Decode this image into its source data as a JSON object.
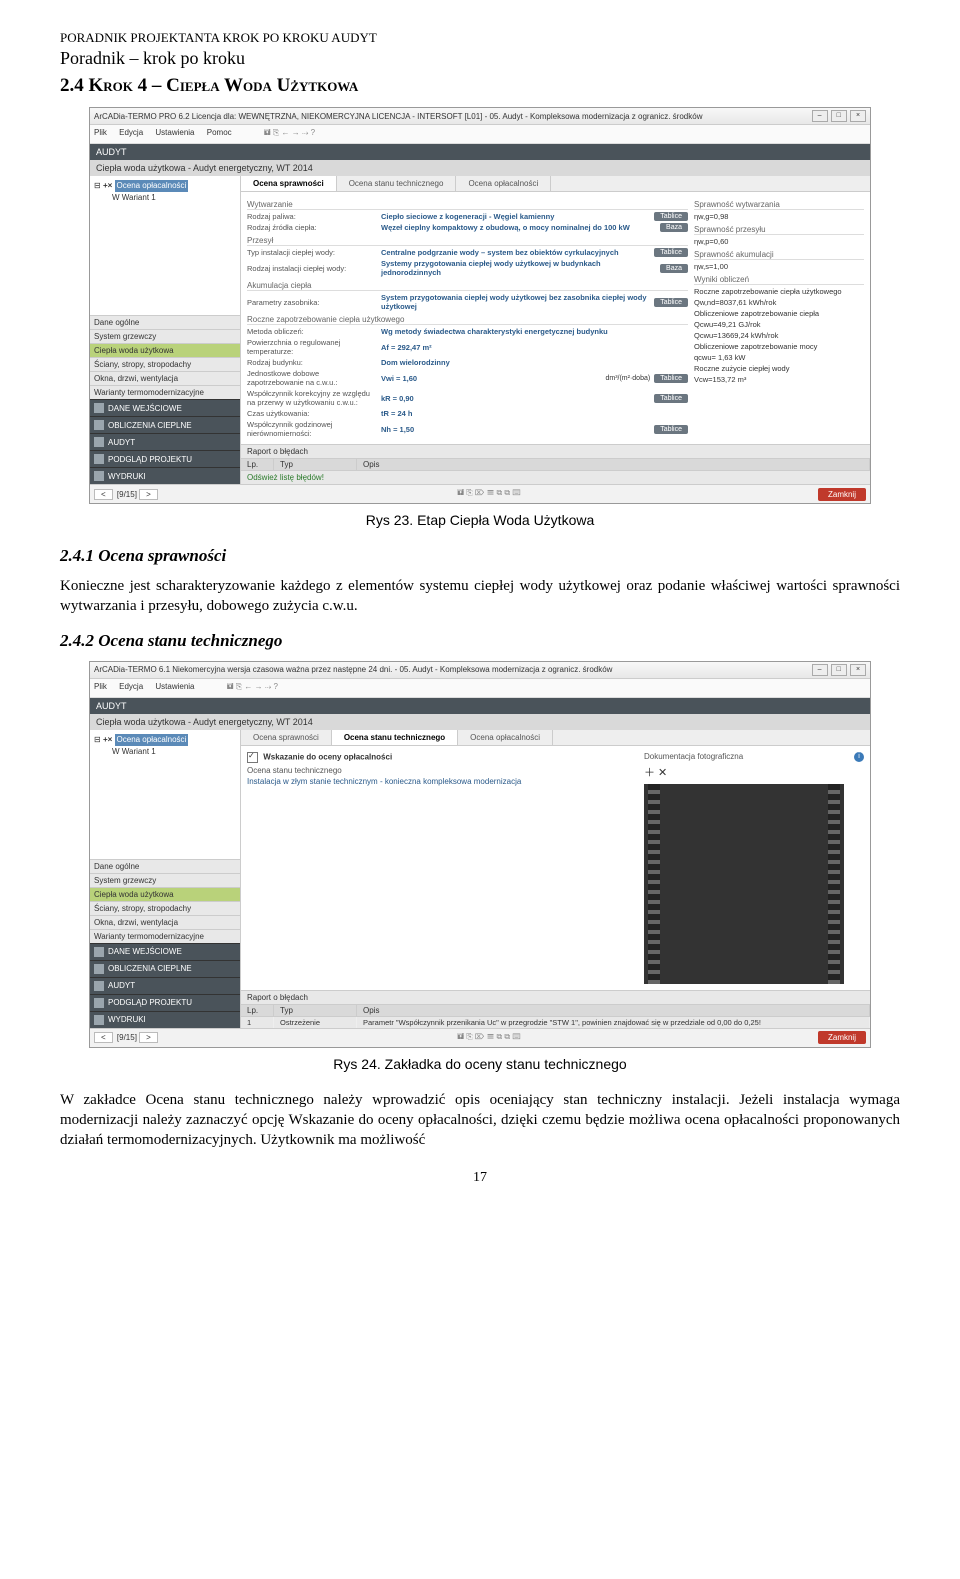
{
  "doc": {
    "header": "PORADNIK PROJEKTANTA KROK PO KROKU AUDYT",
    "subtitle": "Poradnik – krok  po kroku",
    "section": "2.4 Krok 4 – Ciepła Woda Użytkowa",
    "caption1": "Rys 23. Etap Ciepła Woda Użytkowa",
    "sub1_title": "2.4.1  Ocena sprawności",
    "sub1_body": "Konieczne jest scharakteryzowanie każdego z elementów systemu ciepłej wody użytkowej oraz podanie właściwej wartości sprawności wytwarzania i przesyłu, dobowego zużycia c.w.u.",
    "sub2_title": "2.4.2  Ocena stanu technicznego",
    "caption2": "Rys 24. Zakładka do oceny stanu technicznego",
    "final_body": "W zakładce Ocena stanu technicznego należy wprowadzić opis oceniający stan techniczny instalacji. Jeżeli instalacja wymaga modernizacji należy zaznaczyć opcję Wskazanie do oceny opłacalności, dzięki czemu będzie możliwa ocena opłacalności proponowanych działań termomodernizacyjnych. Użytkownik ma możliwość",
    "page_num": "17"
  },
  "app1": {
    "title": "ArCADia-TERMO PRO 6.2 Licencja dla: WEWNĘTRZNA, NIEKOMERCYJNA LICENCJA - INTERSOFT [L01] - 05. Audyt - Kompleksowa modernizacja z ogranicz. środków",
    "menu": [
      "Plik",
      "Edycja",
      "Ustawienia",
      "Pomoc"
    ],
    "audyt_label": "AUDYT",
    "context": "Ciepła woda użytkowa - Audyt energetyczny, WT 2014",
    "tree_top": "Ocena opłacalności",
    "tree_variant": "W  Wariant 1",
    "sidebar_groups": [
      "Dane ogólne",
      "System grzewczy",
      "Ciepła woda użytkowa",
      "Ściany, stropy, stropodachy",
      "Okna, drzwi, wentylacja",
      "Warianty termomodernizacyjne"
    ],
    "sidebar_dark": [
      "DANE WEJŚCIOWE",
      "OBLICZENIA CIEPLNE",
      "AUDYT",
      "PODGLĄD PROJEKTU",
      "WYDRUKI"
    ],
    "tabs": [
      "Ocena sprawności",
      "Ocena stanu technicznego",
      "Ocena opłacalności"
    ],
    "grp_wytwarzanie": "Wytwarzanie",
    "row_rodzaj_paliwa_l": "Rodzaj paliwa:",
    "row_rodzaj_paliwa_v": "Ciepło sieciowe z kogeneracji - Węgiel kamienny",
    "row_rodzaj_zrodla_l": "Rodzaj źródła ciepła:",
    "row_rodzaj_zrodla_v": "Węzeł cieplny kompaktowy z obudową, o mocy nominalnej do 100 kW",
    "grp_przesyl": "Przesył",
    "row_typ_inst_l": "Typ instalacji ciepłej wody:",
    "row_typ_inst_v": "Centralne podgrzanie wody – system bez obiektów cyrkulacyjnych",
    "row_rodzaj_inst_l": "Rodzaj instalacji ciepłej wody:",
    "row_rodzaj_inst_v": "Systemy przygotowania ciepłej wody użytkowej w budynkach jednorodzinnych",
    "grp_akumulacja": "Akumulacja ciepła",
    "row_param_zas_l": "Parametry zasobnika:",
    "row_param_zas_v": "System przygotowania ciepłej wody użytkowej bez zasobnika ciepłej wody użytkowej",
    "grp_roczne": "Roczne zapotrzebowanie ciepła użytkowego",
    "row_metoda_l": "Metoda obliczeń:",
    "row_metoda_v": "Wg metody świadectwa charakterystyki energetycznej budynku",
    "row_pow_l": "Powierzchnia o regulowanej temperaturze:",
    "row_pow_v": "Af = 292,47 m²",
    "row_rodzaj_bud_l": "Rodzaj budynku:",
    "row_rodzaj_bud_v": "Dom wielorodzinny",
    "row_jedn_l": "Jednostkowe dobowe zapotrzebowanie na c.w.u.:",
    "row_jedn_v": "Vwi = 1,60",
    "row_jedn_u": "dm³/(m²·doba)",
    "row_wsp_l": "Współczynnik korekcyjny ze względu na przerwy w użytkowaniu c.w.u.:",
    "row_wsp_v": "kR = 0,90",
    "row_czas_l": "Czas użytkowania:",
    "row_czas_v": "tR = 24 h",
    "row_wsp_godz_l": "Współczynnik godzinowej nierównomierności:",
    "row_wsp_godz_v": "Nh = 1,50",
    "btn_tablice": "Tablice",
    "btn_baza": "Baza",
    "right_grp1": "Sprawność wytwarzania",
    "right_v1": "ηw,g=0,98",
    "right_grp2": "Sprawność przesyłu",
    "right_v2": "ηw,p=0,60",
    "right_grp3": "Sprawność akumulacji",
    "right_v3": "ηw,s=1,00",
    "right_grp4": "Wyniki obliczeń",
    "res1_l": "Roczne zapotrzebowanie ciepła użytkowego",
    "res1_v": "Qw,nd=8037,61 kWh/rok",
    "res2_l": "Obliczeniowe zapotrzebowanie ciepła",
    "res2_v": "Qcwu=49,21 GJ/rok",
    "res3_l": "",
    "res3_v": "Qcwu=13669,24 kWh/rok",
    "res4_l": "Obliczeniowe zapotrzebowanie mocy",
    "res4_v": "qcwu= 1,63 kW",
    "res5_l": "Roczne zużycie ciepłej wody",
    "res5_v": "Vcw=153,72 m³",
    "raport_title": "Raport o błędach",
    "rhdr": [
      "Lp.",
      "Typ",
      "Opis"
    ],
    "refresh": "Odśwież listę błędów!",
    "status_page": "[9/15]",
    "close": "Zamknij"
  },
  "app2": {
    "title": "ArCADia-TERMO 6.1 Niekomercyjna wersja czasowa ważna przez następne 24 dni. - 05. Audyt - Kompleksowa modernizacja z ogranicz. środków",
    "menu": [
      "Plik",
      "Edycja",
      "Ustawienia"
    ],
    "audyt_label": "AUDYT",
    "context": "Ciepła woda użytkowa - Audyt energetyczny, WT 2014",
    "tree_top": "Ocena opłacalności",
    "tree_variant": "W  Wariant 1",
    "sidebar_groups": [
      "Dane ogólne",
      "System grzewczy",
      "Ciepła woda użytkowa",
      "Ściany, stropy, stropodachy",
      "Okna, drzwi, wentylacja",
      "Warianty termomodernizacyjne"
    ],
    "sidebar_dark": [
      "DANE WEJŚCIOWE",
      "OBLICZENIA CIEPLNE",
      "AUDYT",
      "PODGLĄD PROJEKTU",
      "WYDRUKI"
    ],
    "tabs": [
      "Ocena sprawności",
      "Ocena stanu technicznego",
      "Ocena opłacalności"
    ],
    "chk_label": "Wskazanie do oceny opłacalności",
    "sub_label": "Ocena stanu technicznego",
    "desc_text": "Instalacja w złym stanie technicznym - konieczna kompleksowa modernizacja",
    "doc_label": "Dokumentacja fotograficzna",
    "raport_title": "Raport o błędach",
    "rhdr": [
      "Lp.",
      "Typ",
      "Opis"
    ],
    "rrow": [
      "1",
      "Ostrzeżenie",
      "Parametr \"Współczynnik przenikania Uc\" w przegrodzie \"STW 1\", powinien znajdować się w przedziale od 0,00 do 0,25!"
    ],
    "status_page": "[9/15]",
    "close": "Zamknij"
  }
}
